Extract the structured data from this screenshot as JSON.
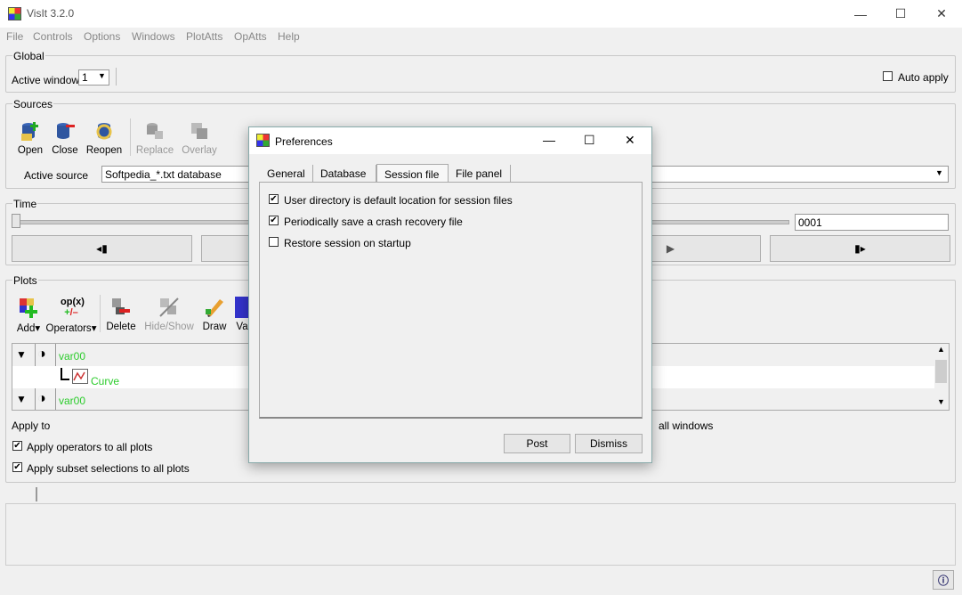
{
  "window": {
    "title": "VisIt 3.2.0",
    "minimize": "—",
    "maximize": "☐",
    "close": "✕"
  },
  "menu": [
    "File",
    "Controls",
    "Options",
    "Windows",
    "PlotAtts",
    "OpAtts",
    "Help"
  ],
  "global": {
    "title": "Global",
    "active_window_label": "Active window",
    "active_window_value": "1",
    "auto_apply_label": "Auto apply"
  },
  "sources": {
    "title": "Sources",
    "buttons": {
      "open": "Open",
      "close": "Close",
      "reopen": "Reopen",
      "replace": "Replace",
      "overlay": "Overlay"
    },
    "active_source_label": "Active source",
    "active_source_value": "Softpedia_*.txt database"
  },
  "time": {
    "title": "Time",
    "frame_value": "0001",
    "prev_label": "◂▮",
    "next_label": "▮▸",
    "play_label": "▶"
  },
  "plots": {
    "title": "Plots",
    "buttons": {
      "add": "Add",
      "operators_icon": "op(x)",
      "operators": "Operators",
      "delete": "Delete",
      "hideshow": "Hide/Show",
      "draw": "Draw",
      "variables": "Va"
    },
    "tree": [
      {
        "name": "var00"
      },
      {
        "name": "Curve"
      },
      {
        "name": "var00"
      }
    ],
    "apply_to_label": "Apply to",
    "all_windows_label": "all windows",
    "apply_operators_label": "Apply operators to all plots",
    "apply_subset_label": "Apply subset selections to all plots"
  },
  "dialog": {
    "title": "Preferences",
    "minimize": "—",
    "maximize": "☐",
    "close": "✕",
    "tabs": [
      "General",
      "Database",
      "Session file",
      "File panel"
    ],
    "options": [
      {
        "label": "User directory is default location for session files",
        "checked": true
      },
      {
        "label": "Periodically save a crash recovery file",
        "checked": true
      },
      {
        "label": "Restore session on startup",
        "checked": false
      }
    ],
    "post_label": "Post",
    "dismiss_label": "Dismiss"
  },
  "colors": {
    "tree_text": "#2ccc2c",
    "dialog_border": "#88aaaa"
  }
}
